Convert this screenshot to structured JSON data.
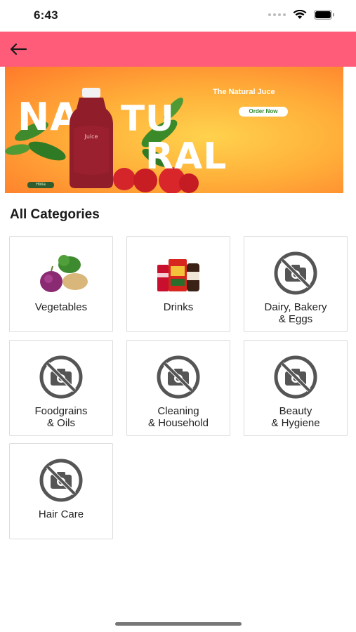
{
  "status_bar": {
    "time": "6:43"
  },
  "banner": {
    "word1": "NA",
    "word2": "TU",
    "word3": "RAL",
    "tagline": "The Natural Juce",
    "cta": "Order Now",
    "badge": "Hinia",
    "bottle_label": "Juice"
  },
  "section_title": "All Categories",
  "categories": [
    {
      "label": "Vegetables"
    },
    {
      "label": "Drinks"
    },
    {
      "label": "Dairy, Bakery\n& Eggs"
    },
    {
      "label": "Foodgrains\n& Oils"
    },
    {
      "label": "Cleaning\n& Household"
    },
    {
      "label": "Beauty\n& Hygiene"
    },
    {
      "label": "Hair Care"
    }
  ],
  "colors": {
    "header": "#ff5c7a",
    "placeholder_icon": "#555555"
  }
}
